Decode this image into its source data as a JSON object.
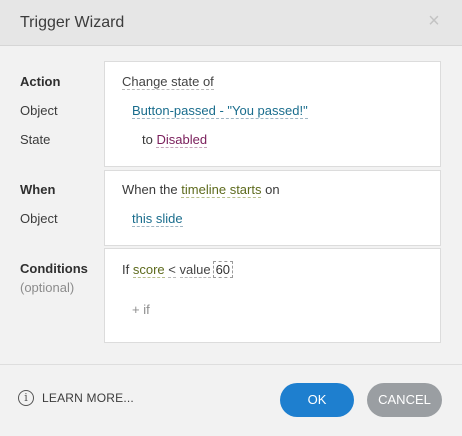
{
  "dialog": {
    "title": "Trigger Wizard",
    "close_glyph": "×"
  },
  "action": {
    "label": "Action",
    "object_label": "Object",
    "state_label": "State",
    "action_value": "Change state of",
    "object_value": "Button-passed - \"You passed!\"",
    "to_word": "to",
    "state_value": "Disabled"
  },
  "when": {
    "label": "When",
    "object_label": "Object",
    "prefix": "When the",
    "event_value": "timeline starts",
    "suffix": "on",
    "object_value": "this slide"
  },
  "conditions": {
    "label": "Conditions",
    "sublabel": "(optional)",
    "if_word": "If",
    "variable": "score",
    "operator": "<",
    "compare_type": "value",
    "compare_value": "60",
    "add_if": "+ if"
  },
  "footer": {
    "info_glyph": "i",
    "learn_more": "LEARN MORE...",
    "ok": "OK",
    "cancel": "CANCEL"
  },
  "colors": {
    "ok_button": "#1e7fcf",
    "cancel_button": "#9a9ea2",
    "link_teal": "#1a6d8d",
    "link_olive": "#5d6a1c",
    "link_purple": "#7a1e5b"
  }
}
